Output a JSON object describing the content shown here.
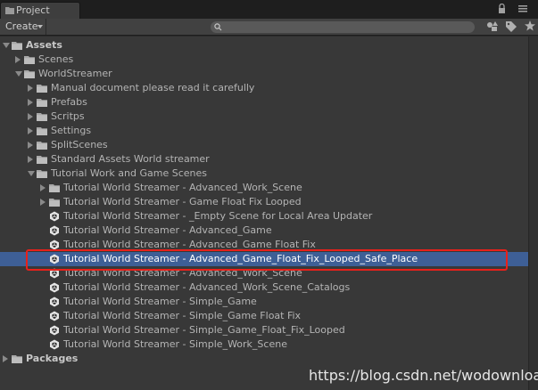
{
  "window": {
    "tab_label": "Project"
  },
  "toolbar": {
    "create_label": "Create",
    "search_placeholder": ""
  },
  "tree": [
    {
      "label": "Assets",
      "depth": 0,
      "expanded": true,
      "kind": "folder",
      "bold": true
    },
    {
      "label": "Scenes",
      "depth": 1,
      "expanded": false,
      "kind": "folder"
    },
    {
      "label": "WorldStreamer",
      "depth": 1,
      "expanded": true,
      "kind": "folder"
    },
    {
      "label": "Manual document please read it carefully",
      "depth": 2,
      "expanded": false,
      "kind": "folder"
    },
    {
      "label": "Prefabs",
      "depth": 2,
      "expanded": false,
      "kind": "folder"
    },
    {
      "label": "Scritps",
      "depth": 2,
      "expanded": false,
      "kind": "folder"
    },
    {
      "label": "Settings",
      "depth": 2,
      "expanded": false,
      "kind": "folder"
    },
    {
      "label": "SplitScenes",
      "depth": 2,
      "expanded": false,
      "kind": "folder"
    },
    {
      "label": "Standard Assets World streamer",
      "depth": 2,
      "expanded": false,
      "kind": "folder"
    },
    {
      "label": "Tutorial Work and Game Scenes",
      "depth": 2,
      "expanded": true,
      "kind": "folder"
    },
    {
      "label": "Tutorial World Streamer - Advanced_Work_Scene",
      "depth": 3,
      "expanded": false,
      "kind": "folder"
    },
    {
      "label": "Tutorial World Streamer - Game Float Fix Looped",
      "depth": 3,
      "expanded": false,
      "kind": "folder"
    },
    {
      "label": "Tutorial World Streamer - _Empty Scene for Local Area Updater",
      "depth": 3,
      "kind": "scene"
    },
    {
      "label": "Tutorial World Streamer - Advanced_Game",
      "depth": 3,
      "kind": "scene"
    },
    {
      "label": "Tutorial World Streamer - Advanced_Game Float Fix",
      "depth": 3,
      "kind": "scene"
    },
    {
      "label": "Tutorial World Streamer - Advanced_Game_Float_Fix_Looped_Safe_Place",
      "depth": 3,
      "kind": "scene",
      "selected": true
    },
    {
      "label": "Tutorial World Streamer - Advanced_Work_Scene",
      "depth": 3,
      "kind": "scene"
    },
    {
      "label": "Tutorial World Streamer - Advanced_Work_Scene_Catalogs",
      "depth": 3,
      "kind": "scene"
    },
    {
      "label": "Tutorial World Streamer - Simple_Game",
      "depth": 3,
      "kind": "scene"
    },
    {
      "label": "Tutorial World Streamer - Simple_Game Float Fix",
      "depth": 3,
      "kind": "scene"
    },
    {
      "label": "Tutorial World Streamer - Simple_Game_Float_Fix_Looped",
      "depth": 3,
      "kind": "scene"
    },
    {
      "label": "Tutorial World Streamer - Simple_Work_Scene",
      "depth": 3,
      "kind": "scene"
    },
    {
      "label": "Packages",
      "depth": 0,
      "expanded": false,
      "kind": "folder",
      "bold": true
    }
  ],
  "watermark": "https://blog.csdn.net/wodownload2",
  "colors": {
    "selection": "#3e5f96",
    "highlight_box": "#e8201a"
  },
  "icons": {
    "folder": "folder-icon",
    "scene": "unity-scene-icon",
    "lock": "lock-icon",
    "menu": "menu-icon",
    "search": "search-icon"
  }
}
